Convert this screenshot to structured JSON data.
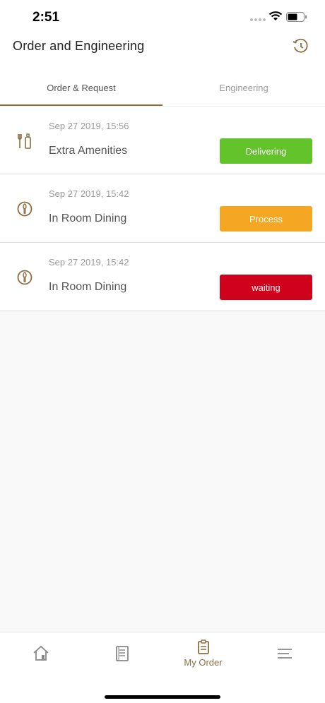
{
  "status_bar": {
    "time": "2:51"
  },
  "header": {
    "title": "Order and Engineering"
  },
  "tabs": [
    {
      "label": "Order & Request"
    },
    {
      "label": "Engineering"
    }
  ],
  "orders": [
    {
      "date": "Sep 27 2019, 15:56",
      "name": "Extra Amenities",
      "status": "Delivering",
      "status_color": "#62c32b",
      "icon": "amenities-icon"
    },
    {
      "date": "Sep 27 2019, 15:42",
      "name": "In Room Dining",
      "status": "Process",
      "status_color": "#f5a623",
      "icon": "dining-icon"
    },
    {
      "date": "Sep 27 2019, 15:42",
      "name": "In Room Dining",
      "status": "waiting",
      "status_color": "#d0021b",
      "icon": "dining-icon"
    }
  ],
  "tab_bar": {
    "my_order_label": "My Order"
  },
  "colors": {
    "accent": "#8c6d3f"
  }
}
